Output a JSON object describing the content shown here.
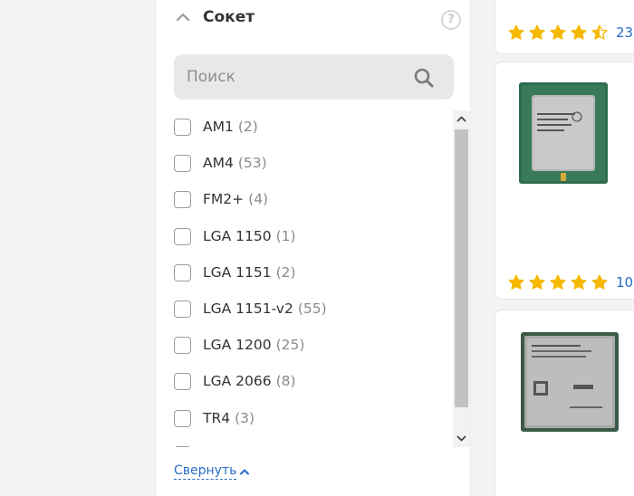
{
  "filter": {
    "title": "Сокет",
    "help_glyph": "?",
    "search": {
      "placeholder": "Поиск",
      "value": ""
    },
    "options": [
      {
        "name": "AM1",
        "count": "(2)"
      },
      {
        "name": "AM4",
        "count": "(53)"
      },
      {
        "name": "FM2+",
        "count": "(4)"
      },
      {
        "name": "LGA 1150",
        "count": "(1)"
      },
      {
        "name": "LGA 1151",
        "count": "(2)"
      },
      {
        "name": "LGA 1151-v2",
        "count": "(55)"
      },
      {
        "name": "LGA 1200",
        "count": "(25)"
      },
      {
        "name": "LGA 2066",
        "count": "(8)"
      },
      {
        "name": "TR4",
        "count": "(3)"
      }
    ],
    "collapse_label": "Свернуть",
    "scroll_position": 0.06,
    "scroll_visible_fraction": 0.92
  },
  "products": [
    {
      "rating": 4.5,
      "reviews": "23"
    },
    {
      "rating": 5,
      "reviews": "10"
    },
    {
      "rating": null,
      "reviews": ""
    }
  ],
  "colors": {
    "accent_link": "#2a6cc7",
    "star": "#f6b800",
    "panel_bg": "#ffffff",
    "page_bg": "#f3f3f3"
  },
  "icons": [
    "chevron-up-icon",
    "help-icon",
    "search-icon",
    "scroll-up-arrow-icon",
    "scroll-down-arrow-icon",
    "star-icon"
  ]
}
